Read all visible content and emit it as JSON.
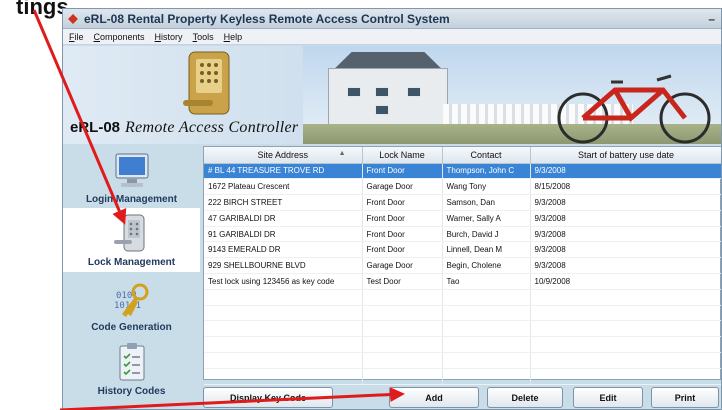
{
  "slide_title": "tings",
  "window": {
    "title": "eRL-08 Rental Property Keyless Remote Access Control System",
    "minimize_glyph": "–"
  },
  "menu": [
    "File",
    "Components",
    "History",
    "Tools",
    "Help"
  ],
  "banner": {
    "model": "eRL-08",
    "script_title": "Remote Access Controller"
  },
  "sidebar": {
    "items": [
      {
        "label": "Login Management",
        "icon": "computer-monitor-icon"
      },
      {
        "label": "Lock Management",
        "icon": "keypad-lock-icon",
        "active": true
      },
      {
        "label": "Code Generation",
        "icon": "key-binary-icon"
      },
      {
        "label": "History Codes",
        "icon": "clipboard-checklist-icon"
      }
    ]
  },
  "table": {
    "columns": [
      "Site Address",
      "Lock Name",
      "Contact",
      "Start of battery use date"
    ],
    "rows": [
      {
        "cells": [
          "# BL 44 TREASURE TROVE RD",
          "Front Door",
          "Thompson, John C",
          "9/3/2008"
        ],
        "selected": true
      },
      {
        "cells": [
          "1672 Plateau Crescent",
          "Garage Door",
          "Wang Tony",
          "8/15/2008"
        ]
      },
      {
        "cells": [
          "222 BIRCH STREET",
          "Front Door",
          "Samson, Dan",
          "9/3/2008"
        ]
      },
      {
        "cells": [
          "47 GARIBALDI DR",
          "Front Door",
          "Warner, Sally A",
          "9/3/2008"
        ]
      },
      {
        "cells": [
          "91 GARIBALDI DR",
          "Front Door",
          "Burch, David J",
          "9/3/2008"
        ]
      },
      {
        "cells": [
          "9143 EMERALD DR",
          "Front Door",
          "Linnell, Dean M",
          "9/3/2008"
        ]
      },
      {
        "cells": [
          "929 SHELLBOURNE BLVD",
          "Garage Door",
          "Begin, Cholene",
          "9/3/2008"
        ]
      },
      {
        "cells": [
          "Test lock using 123456 as key code",
          "Test Door",
          "Tao",
          "10/9/2008"
        ]
      },
      {
        "cells": [
          "",
          "",
          "",
          ""
        ]
      },
      {
        "cells": [
          "",
          "",
          "",
          ""
        ]
      },
      {
        "cells": [
          "",
          "",
          "",
          ""
        ]
      },
      {
        "cells": [
          "",
          "",
          "",
          ""
        ]
      },
      {
        "cells": [
          "",
          "",
          "",
          ""
        ]
      },
      {
        "cells": [
          "",
          "",
          "",
          ""
        ]
      }
    ]
  },
  "buttons": {
    "display_key_code": "Display Key Code",
    "add": "Add",
    "delete": "Delete",
    "edit": "Edit",
    "print": "Print"
  },
  "colors": {
    "annotation_arrow": "#e01b1b",
    "selection": "#3a84d6"
  }
}
